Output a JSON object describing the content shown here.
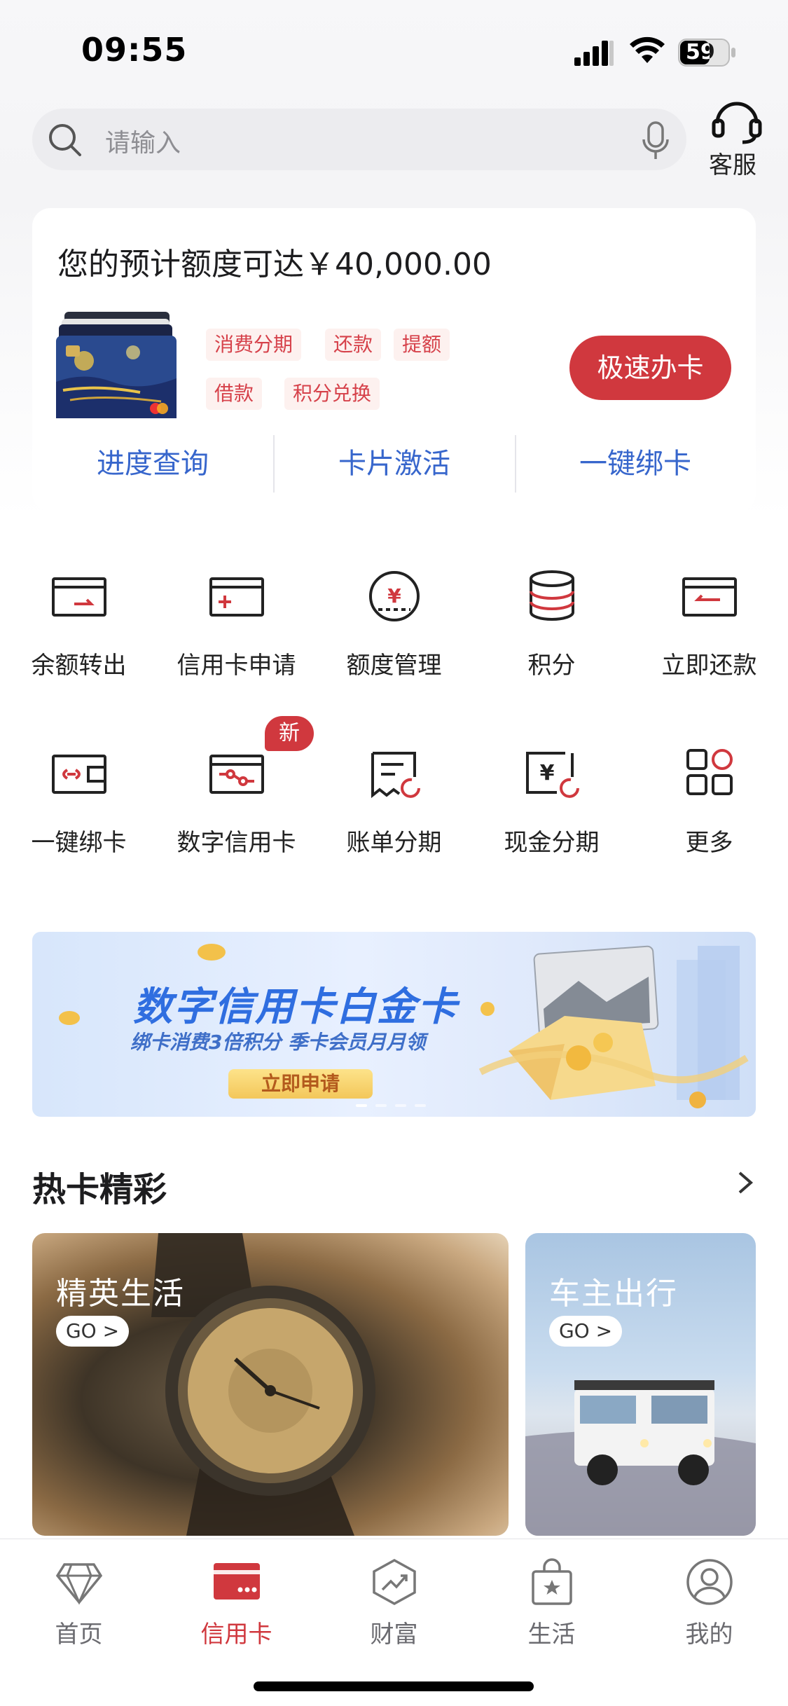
{
  "status_bar": {
    "time": "09:55",
    "battery": "59"
  },
  "search": {
    "placeholder": "请输入"
  },
  "service": {
    "label": "客服"
  },
  "credit_card": {
    "title": "您的预计额度可达￥40,000.00",
    "tags": [
      "消费分期",
      "还款",
      "提额",
      "借款",
      "积分兑换"
    ],
    "apply_button": "极速办卡",
    "links": [
      "进度查询",
      "卡片激活",
      "一键绑卡"
    ]
  },
  "grid": {
    "items": [
      {
        "label": "余额转出",
        "icon": "balance-transfer-icon"
      },
      {
        "label": "信用卡申请",
        "icon": "card-apply-icon"
      },
      {
        "label": "额度管理",
        "icon": "limit-management-icon"
      },
      {
        "label": "积分",
        "icon": "points-icon"
      },
      {
        "label": "立即还款",
        "icon": "repay-icon"
      },
      {
        "label": "一键绑卡",
        "icon": "bind-card-icon"
      },
      {
        "label": "数字信用卡",
        "icon": "digital-card-icon"
      },
      {
        "label": "账单分期",
        "icon": "bill-installment-icon"
      },
      {
        "label": "现金分期",
        "icon": "cash-installment-icon"
      },
      {
        "label": "更多",
        "icon": "more-grid-icon"
      }
    ],
    "new_badge": "新"
  },
  "banner": {
    "title": "数字信用卡白金卡",
    "subtitle": "绑卡消费3倍积分 季卡会员月月领",
    "button": "立即申请"
  },
  "hot_cards": {
    "title": "热卡精彩",
    "cards": [
      {
        "title": "精英生活",
        "go": "GO >"
      },
      {
        "title": "车主出行",
        "go": "GO >"
      }
    ]
  },
  "tab_bar": {
    "tabs": [
      {
        "label": "首页",
        "icon": "diamond-icon"
      },
      {
        "label": "信用卡",
        "icon": "credit-card-icon",
        "active": true
      },
      {
        "label": "财富",
        "icon": "wealth-chart-icon"
      },
      {
        "label": "生活",
        "icon": "shopping-bag-icon"
      },
      {
        "label": "我的",
        "icon": "profile-icon"
      }
    ]
  },
  "colors": {
    "accent": "#d0383e",
    "link": "#3766cc"
  }
}
